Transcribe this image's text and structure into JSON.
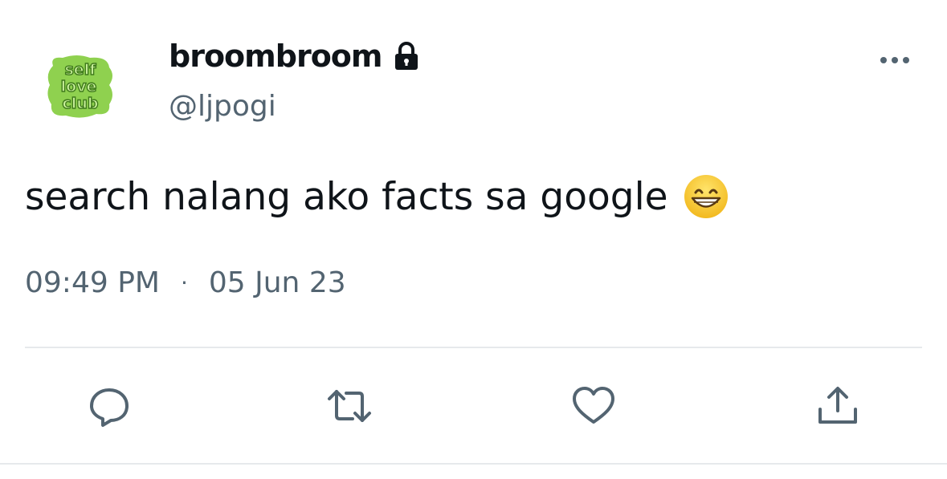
{
  "author": {
    "display_name": "broombroom",
    "handle": "@ljpogi",
    "avatar_text": "self love club",
    "protected_icon": "lock-icon"
  },
  "tweet": {
    "text": "search nalang ako facts sa google",
    "emoji": "grinning-face-with-smiling-eyes",
    "time": "09:49 PM",
    "separator": "·",
    "date": "05 Jun 23"
  },
  "actions": [
    "reply-icon",
    "retweet-icon",
    "like-icon",
    "share-icon"
  ],
  "colors": {
    "text": "#0f1419",
    "secondary": "#536471",
    "avatar_green": "#8fd14f",
    "divider": "#e6e9ec"
  }
}
